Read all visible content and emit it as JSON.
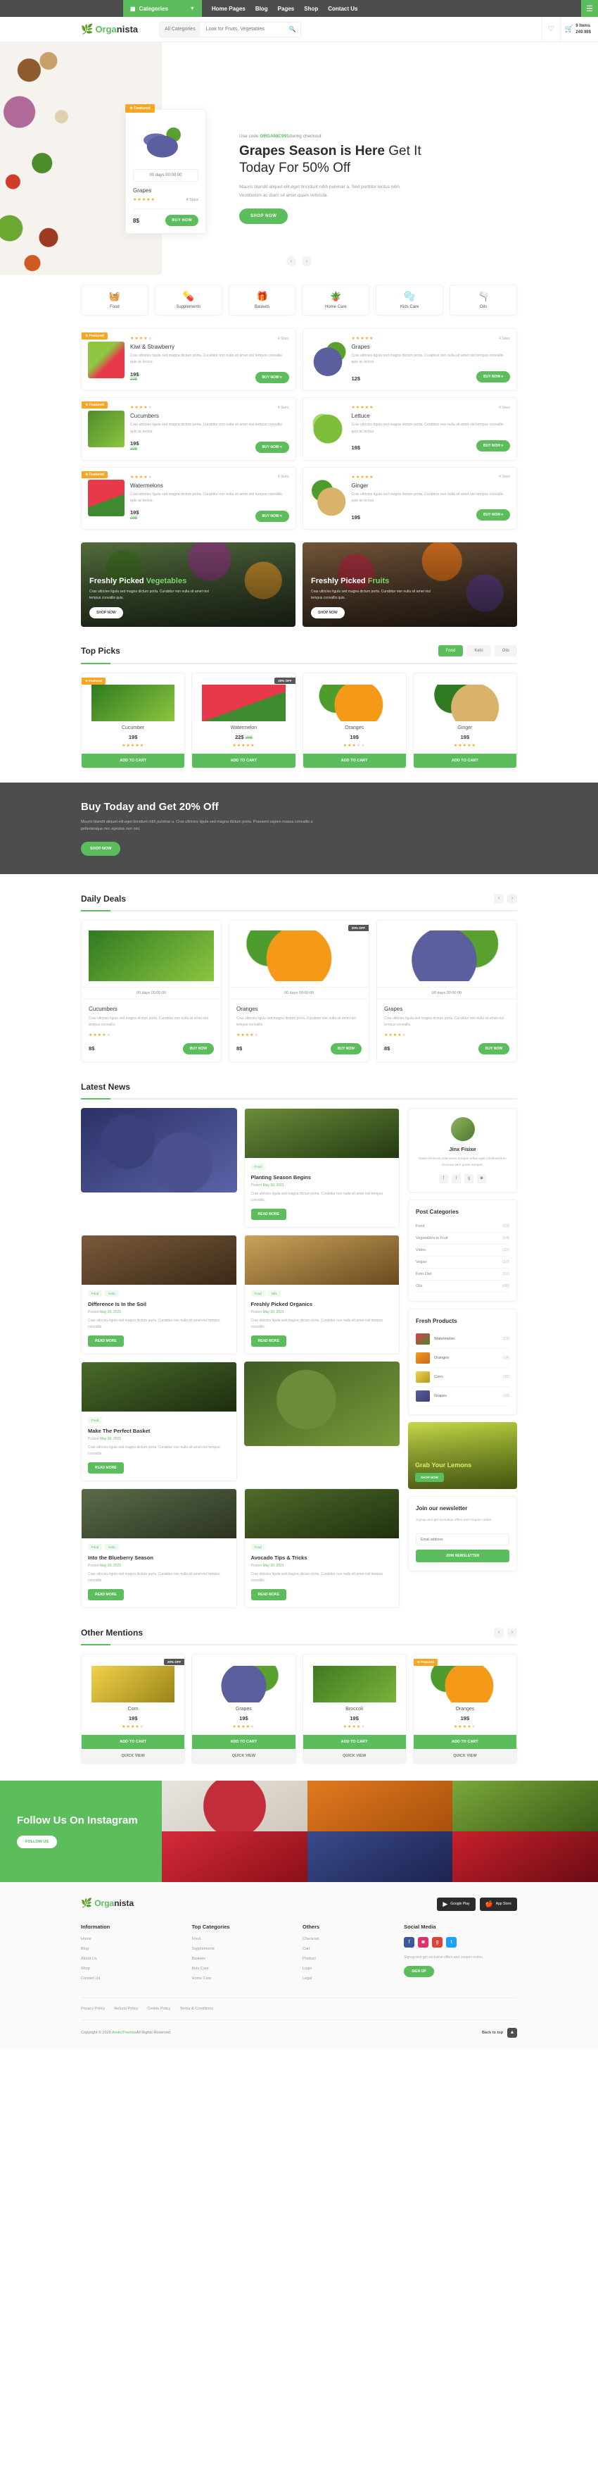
{
  "topbar": {
    "categories_label": "Categories",
    "nav": [
      "Home Pages",
      "Blog",
      "Pages",
      "Shop",
      "Contact Us"
    ],
    "burger_icon": "hamburger-icon"
  },
  "header": {
    "logo_leaf": "leaf-icon",
    "logo_bold": "Orga",
    "logo_rest": "nista",
    "search_category": "All Categories",
    "search_placeholder": "Look for Fruits, Vegetables",
    "search_icon": "search-icon",
    "wishlist_icon": "heart-icon",
    "cart_icon": "cart-icon",
    "cart_items": "9 Items",
    "cart_total": "249.99$"
  },
  "hero": {
    "featured_badge": "Featured",
    "timer": "00 days 00:00:00",
    "product_name": "Grapes",
    "stars": 5,
    "rating_label": "4 Stars",
    "price": "8$",
    "buy_label": "BUY NOW",
    "code_pre": "Use code ",
    "code": "ORGANIC991",
    "code_post": "during checkout",
    "title_bold": "Grapes Season is Here",
    "title_rest": " Get It Today For 50% Off",
    "desc": "Mauris blandit aliquet elit.eget tincidunt nibh pulvinar a. Sed porttitor lectus nibh. Vestibulum ac diam sit amet quam vehicula.",
    "shop_label": "SHOP NOW",
    "prev_icon": "chevron-left-icon",
    "next_icon": "chevron-right-icon"
  },
  "categories": [
    {
      "name": "Food",
      "icon": "food-basket-icon",
      "glyph": "🧺"
    },
    {
      "name": "Supplements",
      "icon": "pills-icon",
      "glyph": "💊"
    },
    {
      "name": "Baskets",
      "icon": "gift-basket-icon",
      "glyph": "🎁"
    },
    {
      "name": "Home Care",
      "icon": "spray-bottle-icon",
      "glyph": "🪴"
    },
    {
      "name": "Kids Care",
      "icon": "kids-care-icon",
      "glyph": "🫧"
    },
    {
      "name": "Oils",
      "icon": "oil-bottle-icon",
      "glyph": "🫗"
    }
  ],
  "products": [
    {
      "name": "Kiwi & Strawberry",
      "badge": "Featured",
      "stars": 4,
      "rating_label": "4 Stars",
      "desc": "Cras ultricies ligula sed magna dictum porta. Curabitur non nulla sit amet nisl tempus convallis quis ac lectus.",
      "price": "19$",
      "old_price": "29$",
      "buy_label": "BUY NOW",
      "img": "linear-gradient(135deg,#8ec63f 40%,#e8394a 60%)"
    },
    {
      "name": "Grapes",
      "badge": "",
      "stars": 5,
      "rating_label": "4 Stars",
      "desc": "Cras ultricies ligula sed magna dictum porta. Curabitur non nulla sit amet nisl tempus convallis quis ac lectus.",
      "price": "12$",
      "old_price": "",
      "buy_label": "BUY NOW",
      "img": "radial-gradient(circle at 50% 55%,#5c5f9e 0 52%,transparent 53%),radial-gradient(circle at 72% 28%,#5aa02e 0 26%,transparent 27%)"
    },
    {
      "name": "Cucumbers",
      "badge": "Featured",
      "stars": 4,
      "rating_label": "4 Stars",
      "desc": "Cras ultricies ligula sed magna dictum porta. Curabitur non nulla sit amet nisl tempus convallis quis ac lectus.",
      "price": "19$",
      "old_price": "29$",
      "buy_label": "BUY NOW",
      "img": "linear-gradient(135deg,#4e8c2a,#8cc63f)"
    },
    {
      "name": "Lettuce",
      "badge": "",
      "stars": 5,
      "rating_label": "4 Stars",
      "desc": "Cras ultricies ligula sed magna dictum porta. Curabitur non nulla sit amet nisl tempus convallis quis ac lectus.",
      "price": "19$",
      "old_price": "",
      "buy_label": "BUY NOW",
      "img": "radial-gradient(circle at 50% 50%,#7dbf3a 0 55%,transparent 56%),radial-gradient(circle at 35% 35%,#a8d86a 0 28%,transparent 29%)"
    },
    {
      "name": "Watermelons",
      "badge": "Featured",
      "stars": 4,
      "rating_label": "4 Stars",
      "desc": "Cras ultricies ligula sed magna dictum porta. Curabitur non nulla sit amet nisl tempus convallis quis ac lectus.",
      "price": "19$",
      "old_price": "29$",
      "buy_label": "BUY NOW",
      "img": "linear-gradient(160deg,#e8394a 55%,#3f8a2e 56%)"
    },
    {
      "name": "Ginger",
      "badge": "",
      "stars": 5,
      "rating_label": "4 Stars",
      "desc": "Cras ultricies ligula sed magna dictum porta. Curabitur non nulla sit amet nisl tempus convallis quis ac lectus.",
      "price": "19$",
      "old_price": "",
      "buy_label": "BUY NOW",
      "img": "radial-gradient(circle at 60% 60%,#d9b36a 0 45%,transparent 46%),radial-gradient(circle at 35% 30%,#4f9c2e 0 30%,transparent 31%)"
    }
  ],
  "promos": [
    {
      "title_a": "Freshly Picked ",
      "title_b": "Vegetables",
      "desc": "Cras ultricies ligula sed magna dictum porta. Curabitur non nulla sit amet nisl tempus convallis quis.",
      "btn": "SHOP NOW",
      "style": "veg"
    },
    {
      "title_a": "Freshly Picked ",
      "title_b": "Fruits",
      "desc": "Cras ultricies ligula sed magna dictum porta. Curabitur non nulla sit amet nisl tempus convallis quis.",
      "btn": "SHOP NOW",
      "style": "fruit"
    }
  ],
  "top_picks": {
    "title": "Top Picks",
    "tabs": [
      "Food",
      "Keto",
      "Oils"
    ],
    "active_tab": "Food",
    "items": [
      {
        "name": "Cucumber",
        "badge": "Featured",
        "badge_type": "feat",
        "price": "19$",
        "old_price": "",
        "stars": 5,
        "btn": "ADD TO CART",
        "img": "linear-gradient(140deg,#2f7a22,#8cc63f)"
      },
      {
        "name": "Watermelon",
        "badge": "20% OFF",
        "badge_type": "dark",
        "price": "22$",
        "old_price": "29$",
        "stars": 5,
        "btn": "ADD TO CART",
        "img": "linear-gradient(160deg,#e8394a 55%,#3f8a2e 56%)"
      },
      {
        "name": "Oranges",
        "badge": "",
        "badge_type": "",
        "price": "19$",
        "old_price": "",
        "stars": 3,
        "btn": "ADD TO CART",
        "img": "radial-gradient(circle at 55% 55%,#f59a18 0 48%,transparent 49%),radial-gradient(circle at 28% 30%,#4f9c2e 0 26%,transparent 27%)"
      },
      {
        "name": "Ginger",
        "badge": "",
        "badge_type": "",
        "price": "19$",
        "old_price": "",
        "stars": 5,
        "btn": "ADD TO CART",
        "img": "radial-gradient(circle at 62% 62%,#d9b36a 0 42%,transparent 43%),radial-gradient(circle at 35% 28%,#2f7a22 0 30%,transparent 31%)"
      }
    ]
  },
  "dark_band": {
    "title": "Buy Today and Get 20% Off",
    "desc": "Mauris blandit aliquet elit.eget tincidunt nibh pulvinar a. Cras ultricies ligula sed magna dictum porta. Praesent sapien massa convallis a pellentesque nec egestas non nisi.",
    "btn": "SHOP NOW"
  },
  "daily_deals": {
    "title": "Daily Deals",
    "prev_icon": "chevron-left-icon",
    "next_icon": "chevron-right-icon",
    "items": [
      {
        "name": "Cucumbers",
        "badge": "",
        "badge_type": "",
        "timer": "00 days 00:00:00",
        "desc": "Cras ultricies ligula sed magna dictum porta. Curabitur non nulla sit amet nisl tempus convallis.",
        "stars": 4,
        "price": "8$",
        "btn": "BUY NOW",
        "img": "linear-gradient(140deg,#2f7a22,#8cc63f)"
      },
      {
        "name": "Oranges",
        "badge": "20% OFF",
        "badge_type": "dark",
        "timer": "00 days 00:00:00",
        "desc": "Cras ultricies ligula sed magna dictum porta. Curabitur non nulla sit amet nisl tempus convallis.",
        "stars": 4,
        "price": "8$",
        "btn": "BUY NOW",
        "img": "radial-gradient(circle at 50% 55%,#f59a18 0 47%,transparent 48%),radial-gradient(circle at 26% 26%,#4f9c2e 0 22%,transparent 23%)"
      },
      {
        "name": "Grapes",
        "badge": "",
        "badge_type": "",
        "timer": "00 days 00:00:00",
        "desc": "Cras ultricies ligula sed magna dictum porta. Curabitur non nulla sit amet nisl tempus convallis.",
        "stars": 4,
        "price": "8$",
        "btn": "BUY NOW",
        "img": "radial-gradient(circle at 48% 58%,#5c5f9e 0 45%,transparent 46%),radial-gradient(circle at 72% 26%,#5aa02e 0 24%,transparent 25%)"
      }
    ]
  },
  "latest_news": {
    "title": "Latest News",
    "read_more": "READ MORE",
    "posted_pre": "Posted ",
    "posted_date": "May 30, 2021",
    "articles": [
      {
        "layout": "image-tall",
        "tags": [],
        "title": "",
        "desc": "",
        "img": "radial-gradient(circle at 30% 40%,#39407a 0 22%,transparent 23%),radial-gradient(circle at 65% 65%,#4a5090 0 26%,transparent 27%),linear-gradient(150deg,#2b3166,#5a63a8)"
      },
      {
        "layout": "card",
        "tags": [
          "Food"
        ],
        "title": "Planting Season Begins",
        "desc": "Cras ultricies ligula sed magna dictum porta. Curabitur non nulla sit amet nisl tempus convallis.",
        "img": "linear-gradient(160deg,#6b8c3a,#243a12)"
      },
      {
        "layout": "card",
        "tags": [
          "Food",
          "Keto"
        ],
        "title": "Difference Is In the Soil",
        "desc": "Cras ultricies ligula sed magna dictum porta. Curabitur non nulla sit amet nisl tempus convallis.",
        "img": "linear-gradient(160deg,#7a5a3a,#3b2a18)"
      },
      {
        "layout": "card",
        "tags": [
          "Food",
          "Oils"
        ],
        "title": "Freshly Picked Organics",
        "desc": "Cras ultricies ligula sed magna dictum porta. Curabitur non nulla sit amet nisl tempus convallis.",
        "img": "linear-gradient(160deg,#c9a35a,#6a4a20)"
      },
      {
        "layout": "card",
        "tags": [
          "Food"
        ],
        "title": "Make The Perfect Basket",
        "desc": "Cras ultricies ligula sed magna dictum porta. Curabitur non nulla sit amet nisl tempus convallis.",
        "img": "linear-gradient(160deg,#4a6b2a,#1d2d10)"
      },
      {
        "layout": "image-tall",
        "tags": [],
        "title": "",
        "desc": "",
        "img": "radial-gradient(circle at 40% 45%,#6b8c3a 0 28%,transparent 29%),linear-gradient(150deg,#3f5a22,#7a9c3a)"
      },
      {
        "layout": "card",
        "tags": [
          "Food",
          "Keto"
        ],
        "title": "Into the Blueberry Season",
        "desc": "Cras ultricies ligula sed magna dictum porta. Curabitur non nulla sit amet nisl tempus convallis.",
        "img": "linear-gradient(160deg,#5a6b4a,#2b3320)"
      },
      {
        "layout": "card",
        "tags": [
          "Food"
        ],
        "title": "Avocado Tips & Tricks",
        "desc": "Cras ultricies ligula sed magna dictum porta. Curabitur non nulla sit amet nisl tempus convallis.",
        "img": "linear-gradient(160deg,#4f6b2a,#20300f)"
      }
    ],
    "sidebar": {
      "author_name": "Jinx Fisixe",
      "author_text": "Etiam rhoncus maecenas tempus tellus eget condimentum rhoncus sem quam semper.",
      "socials": [
        "facebook-icon",
        "twitter-icon",
        "google-icon",
        "instagram-icon"
      ],
      "categories_title": "Post Categories",
      "categories": [
        {
          "name": "Food",
          "count": "(23)"
        },
        {
          "name": "Vegetables in Fruit",
          "count": "(14)"
        },
        {
          "name": "Video",
          "count": "(32)"
        },
        {
          "name": "Vegan",
          "count": "(10)"
        },
        {
          "name": "Keto Diet",
          "count": "(12)"
        },
        {
          "name": "Oils",
          "count": "(08)"
        }
      ],
      "fresh_title": "Fresh Products",
      "fresh": [
        {
          "name": "Watermelon",
          "count": "(23)",
          "img": "linear-gradient(140deg,#e8394a,#3f8a2e)"
        },
        {
          "name": "Oranges",
          "count": "(14)",
          "img": "linear-gradient(140deg,#f59a18,#c96a1e)"
        },
        {
          "name": "Corn",
          "count": "(32)",
          "img": "linear-gradient(140deg,#f2d24a,#b09a20)"
        },
        {
          "name": "Grapes",
          "count": "(10)",
          "img": "linear-gradient(140deg,#5c5f9e,#3a3d70)"
        }
      ],
      "lemon_a": "Grab Your ",
      "lemon_b": "Lemons",
      "lemon_btn": "SHOP NOW",
      "newsletter_title": "Join our newsletter",
      "newsletter_desc": "Signup and get exclusive offers and coupon codes.",
      "newsletter_placeholder": "Email address",
      "newsletter_btn": "JOIN NEWSLETTER"
    }
  },
  "other_mentions": {
    "title": "Other Mentions",
    "prev_icon": "chevron-left-icon",
    "next_icon": "chevron-right-icon",
    "items": [
      {
        "name": "Corn",
        "badge": "20% OFF",
        "badge_type": "dark",
        "price": "19$",
        "old_price": "",
        "stars": 4,
        "btn": "ADD TO CART",
        "quick": "QUICK VIEW",
        "img": "linear-gradient(140deg,#f2d24a,#9a8418)"
      },
      {
        "name": "Grapes",
        "badge": "",
        "badge_type": "",
        "price": "19$",
        "old_price": "",
        "stars": 4,
        "btn": "ADD TO CART",
        "quick": "QUICK VIEW",
        "img": "radial-gradient(circle at 50% 55%,#5c5f9e 0 48%,transparent 49%),radial-gradient(circle at 72% 26%,#5aa02e 0 24%,transparent 25%)"
      },
      {
        "name": "Broccoli",
        "badge": "",
        "badge_type": "",
        "price": "19$",
        "old_price": "",
        "stars": 4,
        "btn": "ADD TO CART",
        "quick": "QUICK VIEW",
        "img": "linear-gradient(140deg,#3f7a22,#7ab33a)"
      },
      {
        "name": "Oranges",
        "badge": "Featured",
        "badge_type": "feat",
        "price": "19$",
        "old_price": "",
        "stars": 4,
        "btn": "ADD TO CART",
        "quick": "QUICK VIEW",
        "img": "radial-gradient(circle at 55% 55%,#f59a18 0 48%,transparent 49%),radial-gradient(circle at 28% 28%,#4f9c2e 0 24%,transparent 25%)"
      }
    ]
  },
  "instagram": {
    "title": "Follow Us On Instagram",
    "btn": "FOLLOW US",
    "tiles": [
      "radial-gradient(circle at 50% 50%,#c22d3a 0 40%,transparent 41%),linear-gradient(150deg,#e8e4dd,#cfc8bd)",
      "linear-gradient(150deg,#e07a20,#a8500c)",
      "linear-gradient(150deg,#7aa83a,#3a5c18)",
      "linear-gradient(150deg,#d62a3a,#8a1018)",
      "linear-gradient(150deg,#3a4a8a,#1c2450)",
      "linear-gradient(150deg,#c8202c,#6a0c14)"
    ]
  },
  "footer": {
    "logo_bold": "Orga",
    "logo_rest": "nista",
    "stores": [
      {
        "icon": "google-play-icon",
        "sub": "Google Play"
      },
      {
        "icon": "apple-icon",
        "sub": "App Store"
      }
    ],
    "columns": [
      {
        "title": "Information",
        "links": [
          "Home",
          "Blog",
          "About Us",
          "Shop",
          "Contact Us"
        ]
      },
      {
        "title": "Top Categories",
        "links": [
          "Food",
          "Supplements",
          "Baskets",
          "Kids Care",
          "Home Care"
        ]
      },
      {
        "title": "Others",
        "links": [
          "Checkout",
          "Cart",
          "Product",
          "Login",
          "Legal"
        ]
      }
    ],
    "social_title": "Social Media",
    "socials": [
      {
        "icon": "facebook-icon",
        "color": "#3b5998"
      },
      {
        "icon": "instagram-icon",
        "color": "#e1306c"
      },
      {
        "icon": "google-icon",
        "color": "#db4437"
      },
      {
        "icon": "twitter-icon",
        "color": "#1da1f2"
      }
    ],
    "social_note": "Signup and get exclusive offers and coupon codes.",
    "signup_btn": "SIGN UP",
    "policies": [
      "Privacy Policy",
      "Refund Policy",
      "Cookie Policy",
      "Terms & Conditions"
    ],
    "copyright_pre": "Copyright © 2020 ",
    "copyright_brand": "AndroThemes",
    "copyright_post": "All Rights Reserved.",
    "back_to_top": "Back to top",
    "back_icon": "chevron-up-icon"
  }
}
